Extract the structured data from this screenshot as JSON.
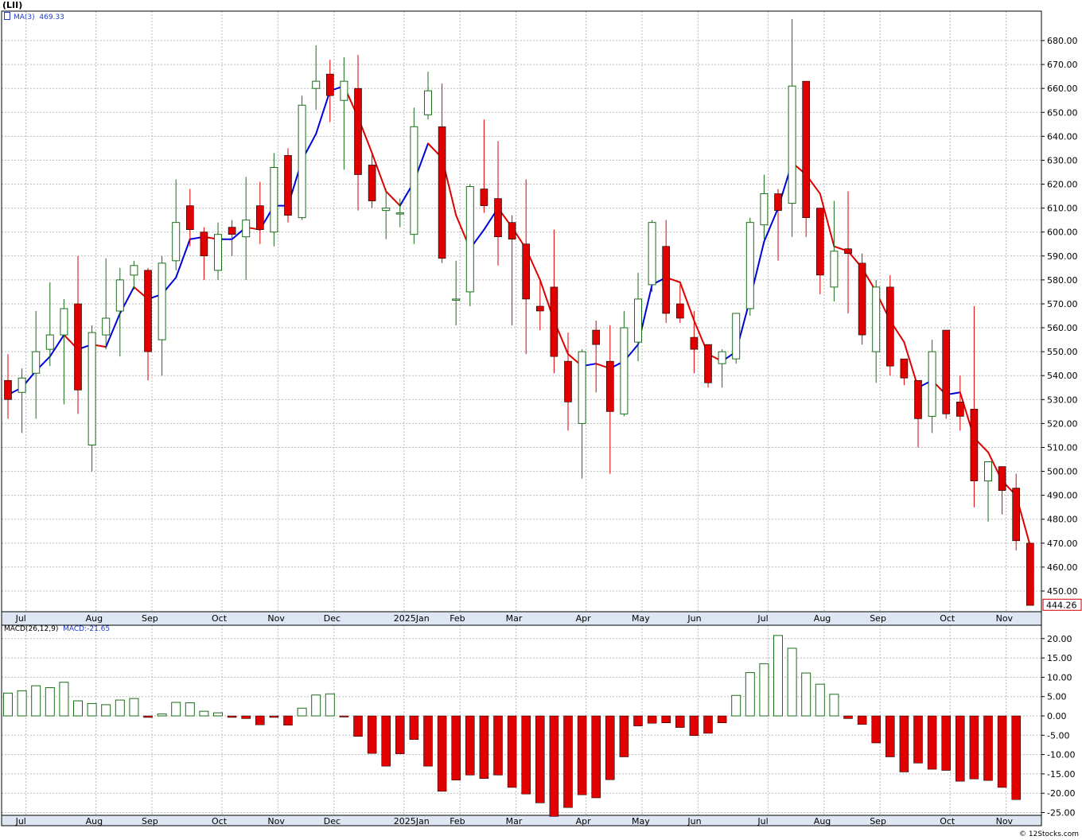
{
  "symbol": "(LII)",
  "price_legend": {
    "icon": "candle-legend-icon",
    "ma_label": "MA(3)",
    "ma_value": "469.33"
  },
  "macd_legend": {
    "label": "MACD(26,12,9)",
    "value_label": "MACD:-21.65"
  },
  "last_price_label": "444.26",
  "footer": "© 12Stocks.com",
  "colors": {
    "up": "#1a6e1a",
    "down": "#e00000",
    "ma_up": "#0000dd",
    "ma_down": "#e00000",
    "grid": "#bbbbbb",
    "label_box": "#cc0000"
  },
  "chart_data": [
    {
      "type": "candlestick",
      "ylim": [
        440,
        690
      ],
      "y_ticks": [
        "450.00",
        "460.00",
        "470.00",
        "480.00",
        "490.00",
        "500.00",
        "510.00",
        "520.00",
        "530.00",
        "540.00",
        "550.00",
        "560.00",
        "570.00",
        "580.00",
        "590.00",
        "600.00",
        "610.00",
        "620.00",
        "630.00",
        "640.00",
        "650.00",
        "660.00",
        "670.00",
        "680.00"
      ],
      "x_labels": [
        {
          "label": "Jul",
          "i": 1
        },
        {
          "label": "Aug",
          "i": 6
        },
        {
          "label": "Sep",
          "i": 10
        },
        {
          "label": "Oct",
          "i": 15
        },
        {
          "label": "Nov",
          "i": 19
        },
        {
          "label": "Dec",
          "i": 23
        },
        {
          "label": "2025Jan",
          "i": 28
        },
        {
          "label": "Feb",
          "i": 32
        },
        {
          "label": "Mar",
          "i": 36
        },
        {
          "label": "Apr",
          "i": 41
        },
        {
          "label": "May",
          "i": 45
        },
        {
          "label": "Jun",
          "i": 49
        },
        {
          "label": "Jul",
          "i": 54
        },
        {
          "label": "Aug",
          "i": 58
        },
        {
          "label": "Sep",
          "i": 62
        },
        {
          "label": "Oct",
          "i": 67
        },
        {
          "label": "Nov",
          "i": 71
        }
      ],
      "candles": [
        {
          "o": 538,
          "h": 549,
          "l": 522,
          "c": 530
        },
        {
          "o": 533,
          "h": 543,
          "l": 516,
          "c": 539
        },
        {
          "o": 541,
          "h": 567,
          "l": 522,
          "c": 550
        },
        {
          "o": 551,
          "h": 579,
          "l": 544,
          "c": 557
        },
        {
          "o": 557,
          "h": 572,
          "l": 528,
          "c": 568
        },
        {
          "o": 570,
          "h": 590,
          "l": 524,
          "c": 534
        },
        {
          "o": 511,
          "h": 561,
          "l": 500,
          "c": 558
        },
        {
          "o": 557,
          "h": 589,
          "l": 551,
          "c": 564
        },
        {
          "o": 567,
          "h": 585,
          "l": 548,
          "c": 580
        },
        {
          "o": 582,
          "h": 588,
          "l": 576,
          "c": 586
        },
        {
          "o": 584,
          "h": 585,
          "l": 538,
          "c": 550
        },
        {
          "o": 555,
          "h": 590,
          "l": 540,
          "c": 587
        },
        {
          "o": 588,
          "h": 622,
          "l": 584,
          "c": 604
        },
        {
          "o": 611,
          "h": 618,
          "l": 594,
          "c": 601
        },
        {
          "o": 600,
          "h": 602,
          "l": 580,
          "c": 590
        },
        {
          "o": 584,
          "h": 604,
          "l": 580,
          "c": 599
        },
        {
          "o": 602,
          "h": 605,
          "l": 590,
          "c": 599
        },
        {
          "o": 598,
          "h": 623,
          "l": 580,
          "c": 605
        },
        {
          "o": 611,
          "h": 621,
          "l": 595,
          "c": 601
        },
        {
          "o": 600,
          "h": 633,
          "l": 594,
          "c": 627
        },
        {
          "o": 632,
          "h": 635,
          "l": 604,
          "c": 607
        },
        {
          "o": 606,
          "h": 657,
          "l": 605,
          "c": 653
        },
        {
          "o": 660,
          "h": 678,
          "l": 651,
          "c": 663
        },
        {
          "o": 666,
          "h": 672,
          "l": 646,
          "c": 657
        },
        {
          "o": 655,
          "h": 673,
          "l": 626,
          "c": 663
        },
        {
          "o": 660,
          "h": 674,
          "l": 609,
          "c": 624
        },
        {
          "o": 628,
          "h": 633,
          "l": 610,
          "c": 613
        },
        {
          "o": 609,
          "h": 618,
          "l": 597,
          "c": 610
        },
        {
          "o": 608,
          "h": 614,
          "l": 602,
          "c": 608
        },
        {
          "o": 599,
          "h": 652,
          "l": 595,
          "c": 644
        },
        {
          "o": 649,
          "h": 667,
          "l": 647,
          "c": 659
        },
        {
          "o": 644,
          "h": 662,
          "l": 587,
          "c": 589
        },
        {
          "o": 572,
          "h": 588,
          "l": 561,
          "c": 572
        },
        {
          "o": 575,
          "h": 620,
          "l": 569,
          "c": 619
        },
        {
          "o": 618,
          "h": 647,
          "l": 608,
          "c": 611
        },
        {
          "o": 614,
          "h": 638,
          "l": 586,
          "c": 598
        },
        {
          "o": 604,
          "h": 607,
          "l": 561,
          "c": 597
        },
        {
          "o": 595,
          "h": 622,
          "l": 549,
          "c": 572
        },
        {
          "o": 569,
          "h": 580,
          "l": 559,
          "c": 567
        },
        {
          "o": 577,
          "h": 601,
          "l": 541,
          "c": 548
        },
        {
          "o": 546,
          "h": 558,
          "l": 517,
          "c": 529
        },
        {
          "o": 520,
          "h": 551,
          "l": 497,
          "c": 550
        },
        {
          "o": 559,
          "h": 563,
          "l": 533,
          "c": 553
        },
        {
          "o": 546,
          "h": 561,
          "l": 499,
          "c": 525
        },
        {
          "o": 524,
          "h": 567,
          "l": 523,
          "c": 560
        },
        {
          "o": 554,
          "h": 583,
          "l": 546,
          "c": 572
        },
        {
          "o": 578,
          "h": 605,
          "l": 575,
          "c": 604
        },
        {
          "o": 594,
          "h": 605,
          "l": 562,
          "c": 566
        },
        {
          "o": 570,
          "h": 578,
          "l": 562,
          "c": 564
        },
        {
          "o": 556,
          "h": 567,
          "l": 541,
          "c": 551
        },
        {
          "o": 553,
          "h": 553,
          "l": 535,
          "c": 537
        },
        {
          "o": 545,
          "h": 551,
          "l": 535,
          "c": 550
        },
        {
          "o": 547,
          "h": 563,
          "l": 545,
          "c": 566
        },
        {
          "o": 568,
          "h": 606,
          "l": 565,
          "c": 604
        },
        {
          "o": 603,
          "h": 624,
          "l": 597,
          "c": 616
        },
        {
          "o": 616,
          "h": 618,
          "l": 588,
          "c": 609
        },
        {
          "o": 612,
          "h": 689,
          "l": 598,
          "c": 661
        },
        {
          "o": 663,
          "h": 663,
          "l": 598,
          "c": 606
        },
        {
          "o": 610,
          "h": 610,
          "l": 574,
          "c": 582
        },
        {
          "o": 577,
          "h": 613,
          "l": 571,
          "c": 592
        },
        {
          "o": 593,
          "h": 617,
          "l": 566,
          "c": 591
        },
        {
          "o": 587,
          "h": 591,
          "l": 553,
          "c": 557
        },
        {
          "o": 550,
          "h": 580,
          "l": 537,
          "c": 577
        },
        {
          "o": 577,
          "h": 582,
          "l": 540,
          "c": 544
        },
        {
          "o": 547,
          "h": 547,
          "l": 536,
          "c": 539
        },
        {
          "o": 538,
          "h": 538,
          "l": 510,
          "c": 522
        },
        {
          "o": 523,
          "h": 555,
          "l": 516,
          "c": 550
        },
        {
          "o": 559,
          "h": 559,
          "l": 522,
          "c": 524
        },
        {
          "o": 529,
          "h": 540,
          "l": 517,
          "c": 523
        },
        {
          "o": 526,
          "h": 569,
          "l": 485,
          "c": 496
        },
        {
          "o": 496,
          "h": 503,
          "l": 479,
          "c": 504
        },
        {
          "o": 502,
          "h": 502,
          "l": 482,
          "c": 492
        },
        {
          "o": 493,
          "h": 499,
          "l": 467,
          "c": 471
        },
        {
          "o": 470,
          "h": 470,
          "l": 444,
          "c": 444
        }
      ],
      "ma3": [
        532,
        535,
        542,
        548,
        557,
        551,
        553,
        552,
        566,
        577,
        572,
        574,
        581,
        597,
        598,
        597,
        597,
        602,
        601,
        611,
        611,
        630,
        641,
        659,
        661,
        648,
        633,
        617,
        611,
        621,
        637,
        631,
        607,
        593,
        601,
        610,
        602,
        593,
        580,
        563,
        549,
        544,
        545,
        543,
        546,
        553,
        578,
        581,
        579,
        563,
        549,
        546,
        550,
        572,
        596,
        610,
        629,
        624,
        616,
        594,
        592,
        585,
        575,
        563,
        554,
        535,
        538,
        532,
        533,
        514,
        508,
        496,
        490,
        469
      ]
    },
    {
      "type": "bar",
      "name": "MACD(26,12,9)",
      "ylim": [
        -26,
        22
      ],
      "y_ticks": [
        "20.00",
        "15.00",
        "10.00",
        "5.00",
        "0.00",
        "-5.00",
        "-10.00",
        "-15.00",
        "-20.00",
        "-25.00"
      ],
      "values": [
        5.9,
        6.5,
        7.8,
        7.3,
        8.7,
        3.9,
        3.2,
        2.9,
        4.1,
        4.5,
        -0.4,
        0.5,
        3.5,
        3.4,
        1.2,
        0.8,
        -0.4,
        -0.7,
        -2.3,
        -0.4,
        -2.4,
        2.0,
        5.4,
        5.7,
        -0.3,
        -5.3,
        -9.7,
        -13.0,
        -9.8,
        -6.1,
        -13.0,
        -19.5,
        -16.6,
        -15.3,
        -16.2,
        -15.3,
        -18.5,
        -20.2,
        -22.5,
        -26.0,
        -23.7,
        -20.4,
        -21.2,
        -16.5,
        -10.6,
        -2.6,
        -1.9,
        -1.8,
        -3.0,
        -5.1,
        -4.5,
        -1.8,
        5.3,
        11.2,
        13.5,
        20.8,
        17.5,
        11.1,
        8.2,
        5.6,
        -0.7,
        -2.2,
        -7.0,
        -10.6,
        -14.5,
        -12.2,
        -13.8,
        -14.1,
        -16.9,
        -16.3,
        -16.7,
        -18.5,
        -21.65
      ]
    }
  ]
}
